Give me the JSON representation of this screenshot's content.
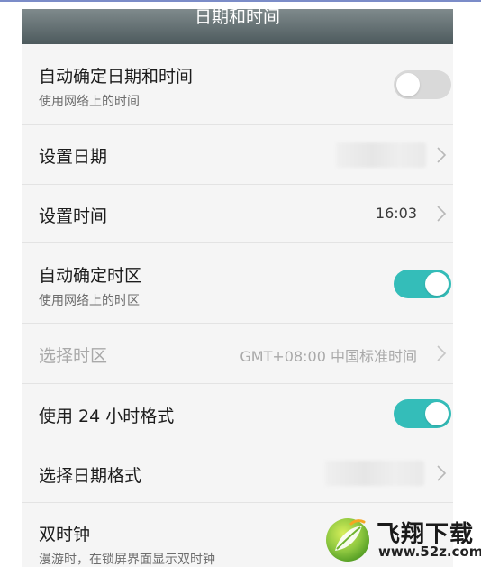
{
  "header": {
    "title": "日期和时间"
  },
  "settings": {
    "auto_datetime": {
      "label": "自动确定日期和时间",
      "subtitle": "使用网络上的时间",
      "toggle_on": false
    },
    "set_date": {
      "label": "设置日期"
    },
    "set_time": {
      "label": "设置时间",
      "value": "16:03"
    },
    "auto_timezone": {
      "label": "自动确定时区",
      "subtitle": "使用网络上的时区",
      "toggle_on": true
    },
    "select_timezone": {
      "label": "选择时区",
      "value": "GMT+08:00 中国标准时间",
      "enabled": false
    },
    "use_24h": {
      "label": "使用 24 小时格式",
      "toggle_on": true
    },
    "date_format": {
      "label": "选择日期格式"
    },
    "dual_clock": {
      "label": "双时钟",
      "subtitle": "漫游时，在锁屏界面显示双时钟"
    }
  },
  "watermark": {
    "brand": "飞翔下载",
    "url": "www.52z.com"
  },
  "colors": {
    "toggle_on": "#34bdb9",
    "toggle_off": "#d9d9d9",
    "header_bg": "#5e6a6d",
    "list_bg": "#f5f5f5",
    "disabled_text": "#a9a9a9"
  },
  "icons": {
    "chevron": "chevron-right-icon",
    "logo": "leaf-logo-icon"
  }
}
